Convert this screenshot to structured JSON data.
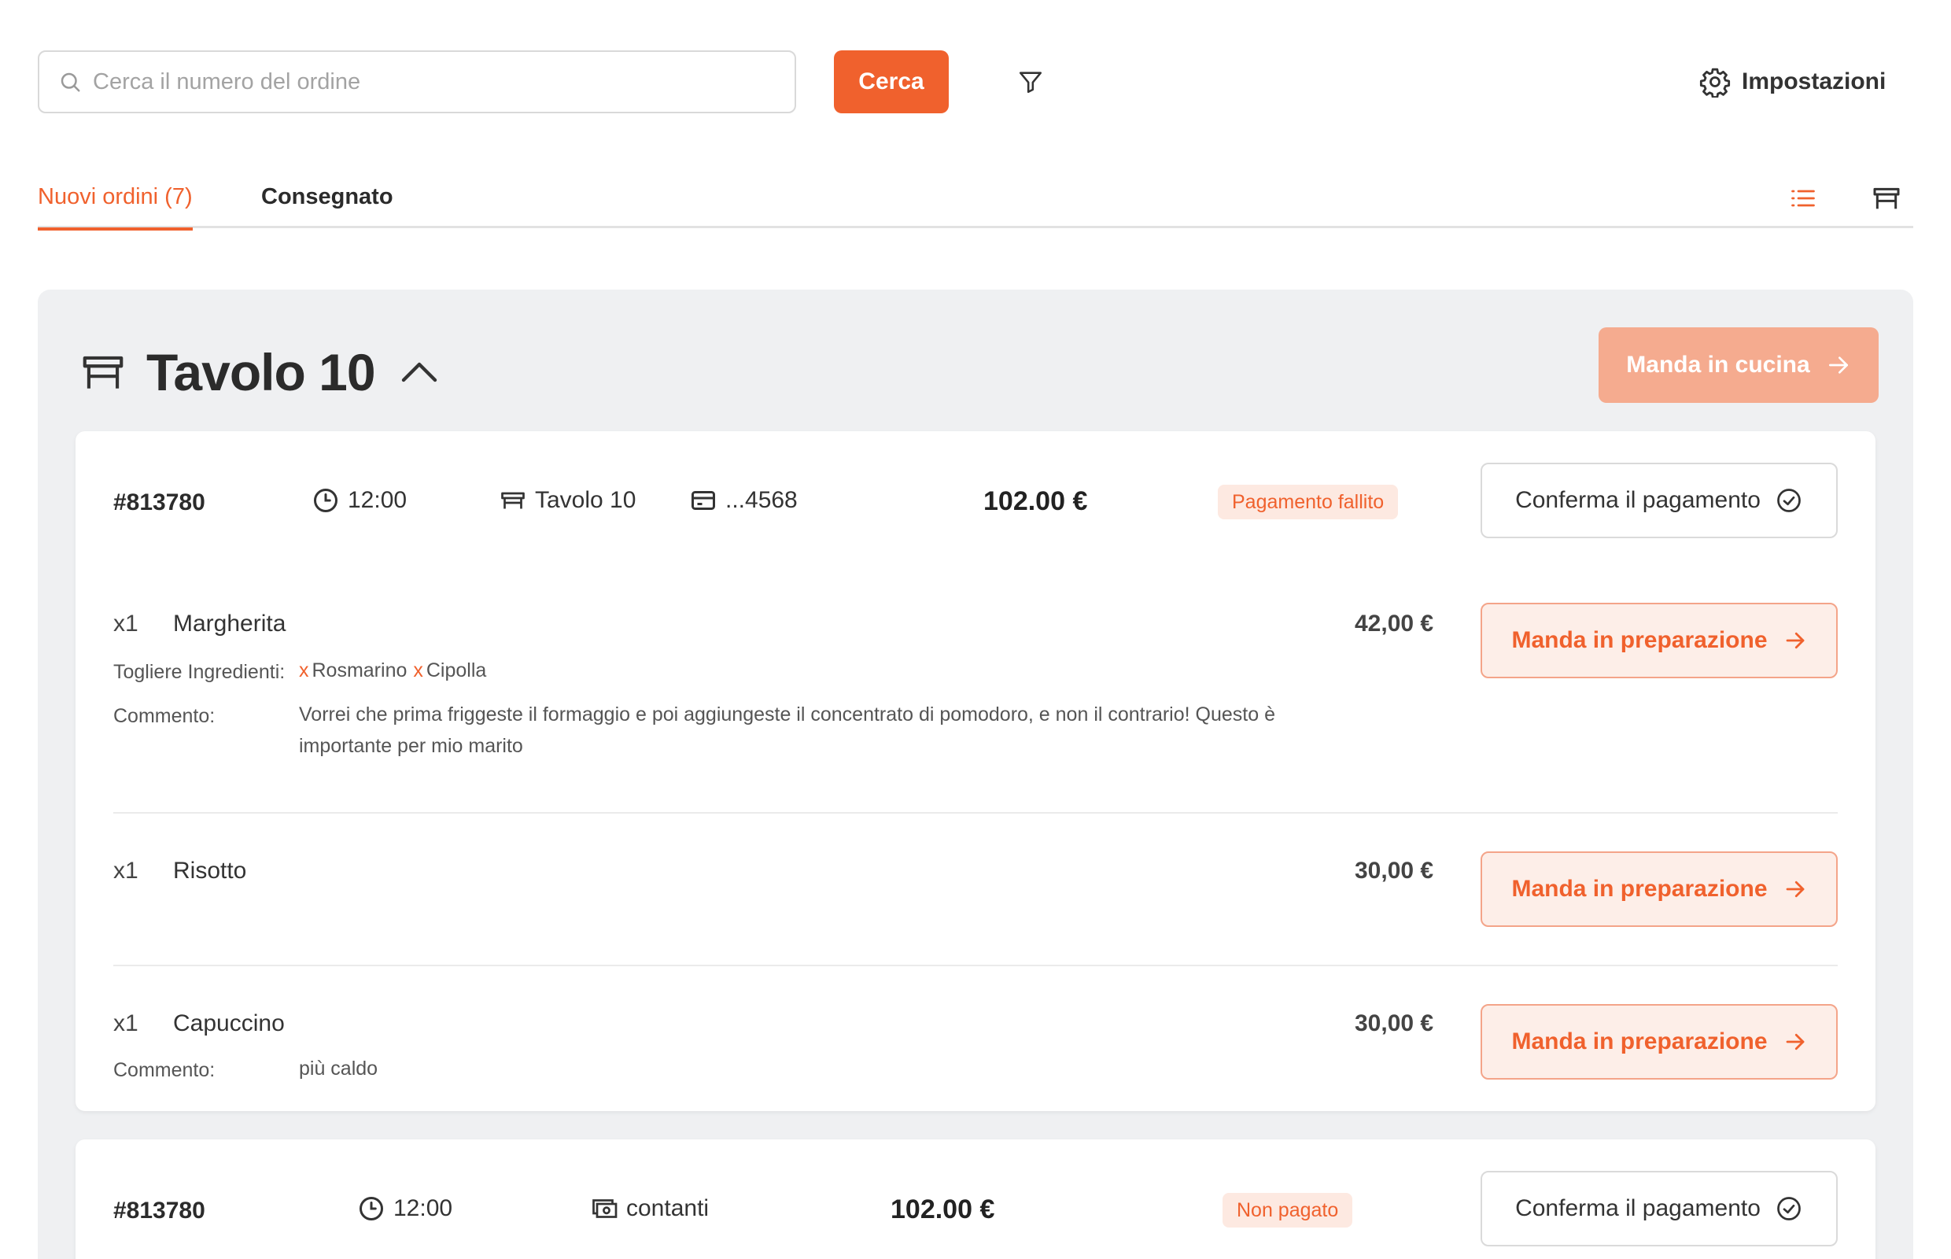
{
  "search": {
    "placeholder": "Cerca il numero del ordine",
    "button": "Cerca"
  },
  "settings": {
    "label": "Impostazioni"
  },
  "tabs": [
    {
      "label": "Nuovi ordini (7)",
      "active": true
    },
    {
      "label": "Consegnato",
      "active": false
    }
  ],
  "group": {
    "title": "Tavolo 10",
    "send_kitchen": "Manda in cucina"
  },
  "orders": [
    {
      "id": "#813780",
      "time": "12:00",
      "table": "Tavolo 10",
      "payment": "...4568",
      "total": "102.00 €",
      "status": "Pagamento fallito",
      "confirm": "Conferma il pagamento",
      "items": [
        {
          "qty": "x1",
          "name": "Margherita",
          "price": "42,00 €",
          "remove_label": "Togliere Ingredienti:",
          "removed": [
            "Rosmarino",
            "Cipolla"
          ],
          "comment_label": "Commento:",
          "comment_line1": "Vorrei che prima friggeste il formaggio e poi aggiungeste il concentrato di pomodoro, e non il contrario! Questo è",
          "comment_line2": "importante per mio marito",
          "action": "Manda in preparazione"
        },
        {
          "qty": "x1",
          "name": "Risotto",
          "price": "30,00 €",
          "action": "Manda in preparazione"
        },
        {
          "qty": "x1",
          "name": "Capuccino",
          "price": "30,00 €",
          "comment_label": "Commento:",
          "comment": "più caldo",
          "action": "Manda in preparazione"
        }
      ]
    },
    {
      "id": "#813780",
      "time": "12:00",
      "payment": "contanti",
      "total": "102.00 €",
      "status": "Non pagato",
      "confirm": "Conferma il pagamento"
    }
  ],
  "icons": {
    "search": "search-icon",
    "filter": "filter-icon",
    "settings": "gear-icon",
    "list_view": "list-icon",
    "table_view": "table-icon",
    "clock": "clock-icon",
    "card": "credit-card-icon",
    "cash": "cash-icon",
    "check": "check-circle-icon",
    "arrow": "arrow-right-icon"
  },
  "colors": {
    "accent": "#f0612d",
    "accent_light": "#fdeee8",
    "group_bg": "#eff0f2"
  }
}
